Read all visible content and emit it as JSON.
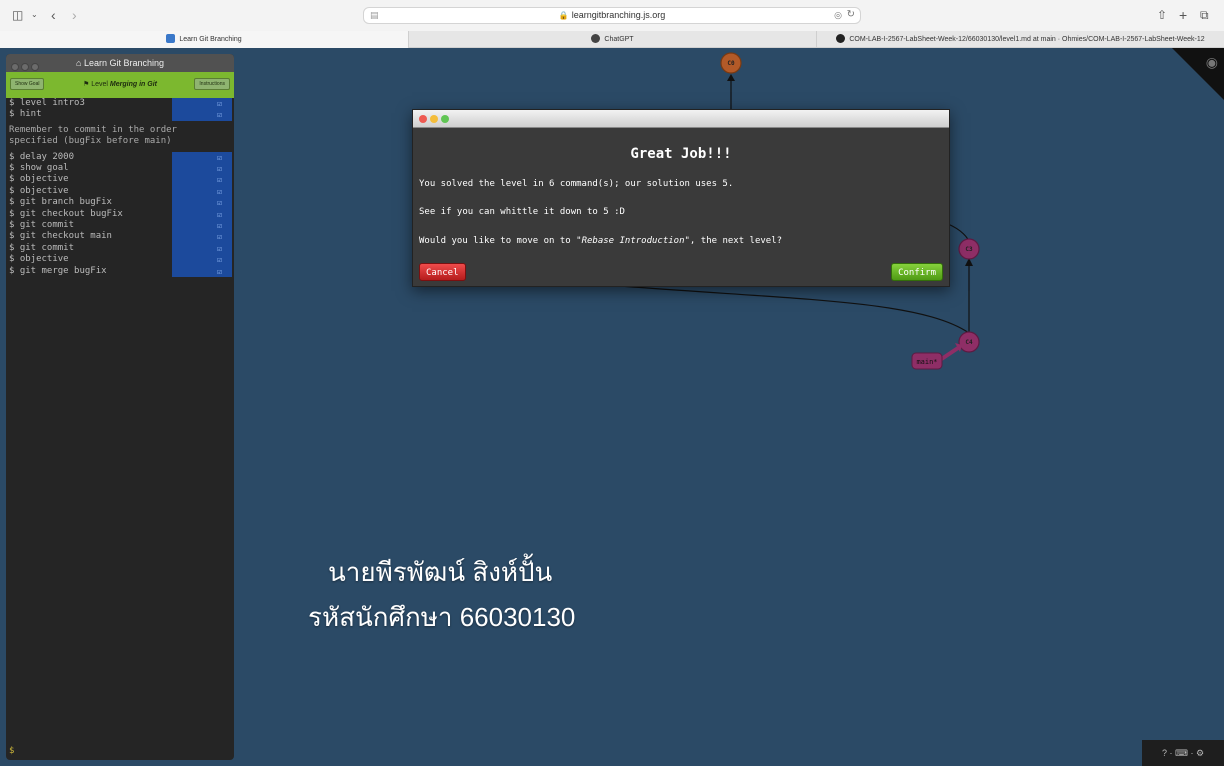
{
  "browser": {
    "url": "learngitbranching.js.org",
    "tabs": [
      {
        "label": "Learn Git Branching",
        "active": true
      },
      {
        "label": "ChatGPT",
        "active": false
      },
      {
        "label": "COM-LAB-I-2567-LabSheet-Week-12/66030130/level1.md at main · Ohmies/COM-LAB-I-2567-LabSheet-Week-12",
        "active": false
      }
    ]
  },
  "panel": {
    "title": "Learn Git Branching",
    "show_goal": "Show Goal",
    "instructions": "Instructions",
    "level_prefix": "Level",
    "level_name": "Merging in Git",
    "note": "Remember to commit in the order\nspecified (bugFix before main)",
    "commands_before": [
      "$ level intro3",
      "$ hint"
    ],
    "commands_after": [
      "$ delay 2000",
      "$ show goal",
      "$ objective",
      "$ objective",
      "$ git branch bugFix",
      "$ git checkout bugFix",
      "$ git commit",
      "$ git checkout main",
      "$ git commit",
      "$ objective",
      "$ git merge bugFix"
    ],
    "prompt": "$"
  },
  "graph": {
    "nodes": [
      "C0",
      "C3",
      "C4"
    ],
    "branch_label": "main*",
    "colors": {
      "c0": "#b35a28",
      "commit": "#8e2e66",
      "branch": "#8e2e66"
    }
  },
  "modal": {
    "title": "Great Job!!!",
    "line1": "You solved the level in 6 command(s); our solution uses 5.",
    "line2": "See if you can whittle it down to 5 :D",
    "line3_pre": "Would you like to move on to \"",
    "line3_level": "Rebase Introduction",
    "line3_post": "\", the next level?",
    "cancel": "Cancel",
    "confirm": "Confirm"
  },
  "overlay": {
    "name": "นายพีรพัฒน์ สิงห์ปั้น",
    "student_id": "รหัสนักศึกษา 66030130"
  },
  "helpbar": "? · ⌨ · ⚙"
}
